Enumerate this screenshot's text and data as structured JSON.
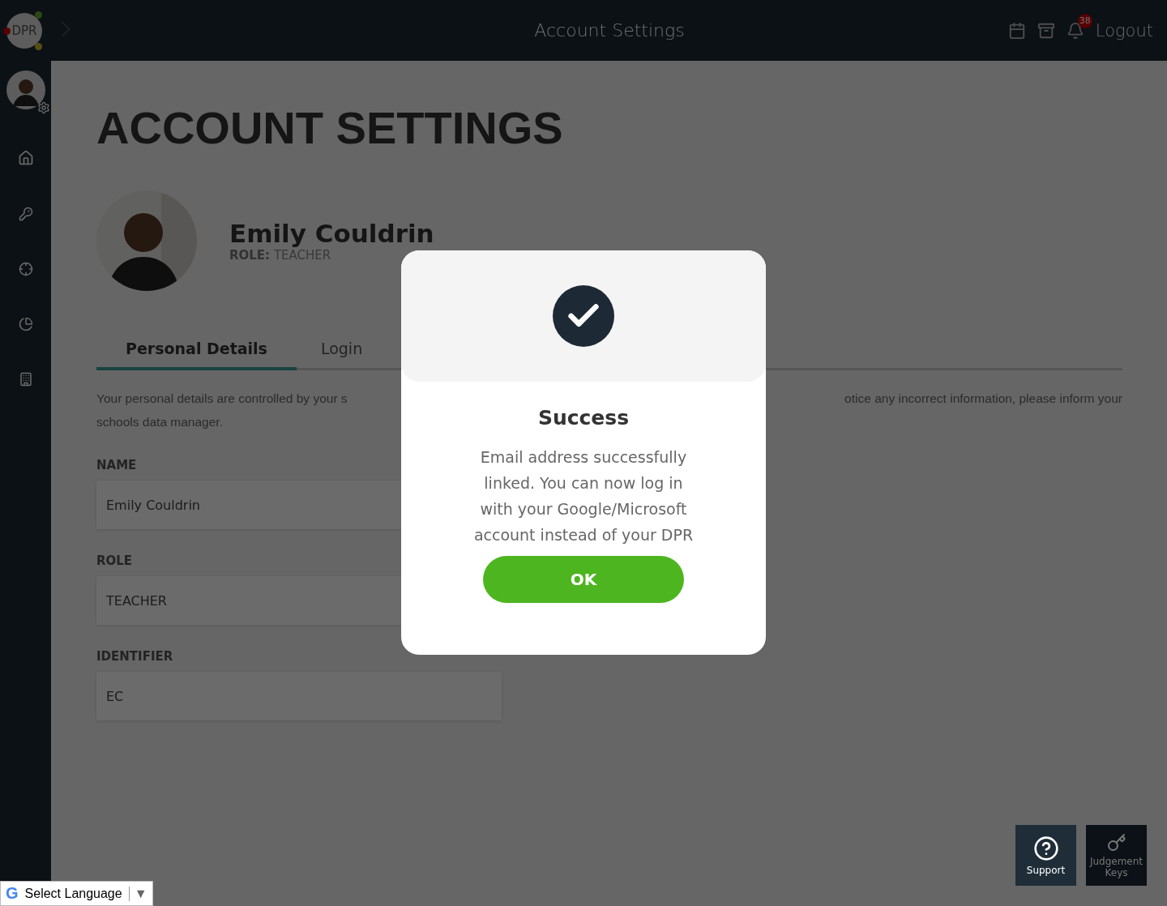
{
  "topbar": {
    "logo": "DPR",
    "title": "Account Settings",
    "notifications": "38",
    "logout": "Logout"
  },
  "page": {
    "heading": "ACCOUNT SETTINGS",
    "profile": {
      "name": "Emily Couldrin",
      "role_label": "ROLE:",
      "role": "TEACHER"
    },
    "tabs": [
      {
        "label": "Personal Details",
        "selected": true
      },
      {
        "label": "Login",
        "selected": false
      }
    ],
    "intro_left": [
      "Your personal details are controlled by your s",
      "schools data manager."
    ],
    "intro_right": "otice any incorrect information, please inform your",
    "fields": [
      {
        "label": "NAME",
        "value": "Emily Couldrin"
      },
      {
        "label": "ROLE",
        "value": "TEACHER"
      },
      {
        "label": "IDENTIFIER",
        "value": "EC"
      }
    ]
  },
  "dialog": {
    "title": "Success",
    "message": "Email address successfully linked. You can now log in with your Google/Microsoft account instead of your DPR",
    "button": "OK"
  },
  "help_buttons": [
    {
      "label": "Support",
      "selected": true
    },
    {
      "label": "Judgement Keys",
      "selected": false
    }
  ],
  "language": {
    "logo": "G",
    "label": "Select Language",
    "arrow": "▼"
  }
}
